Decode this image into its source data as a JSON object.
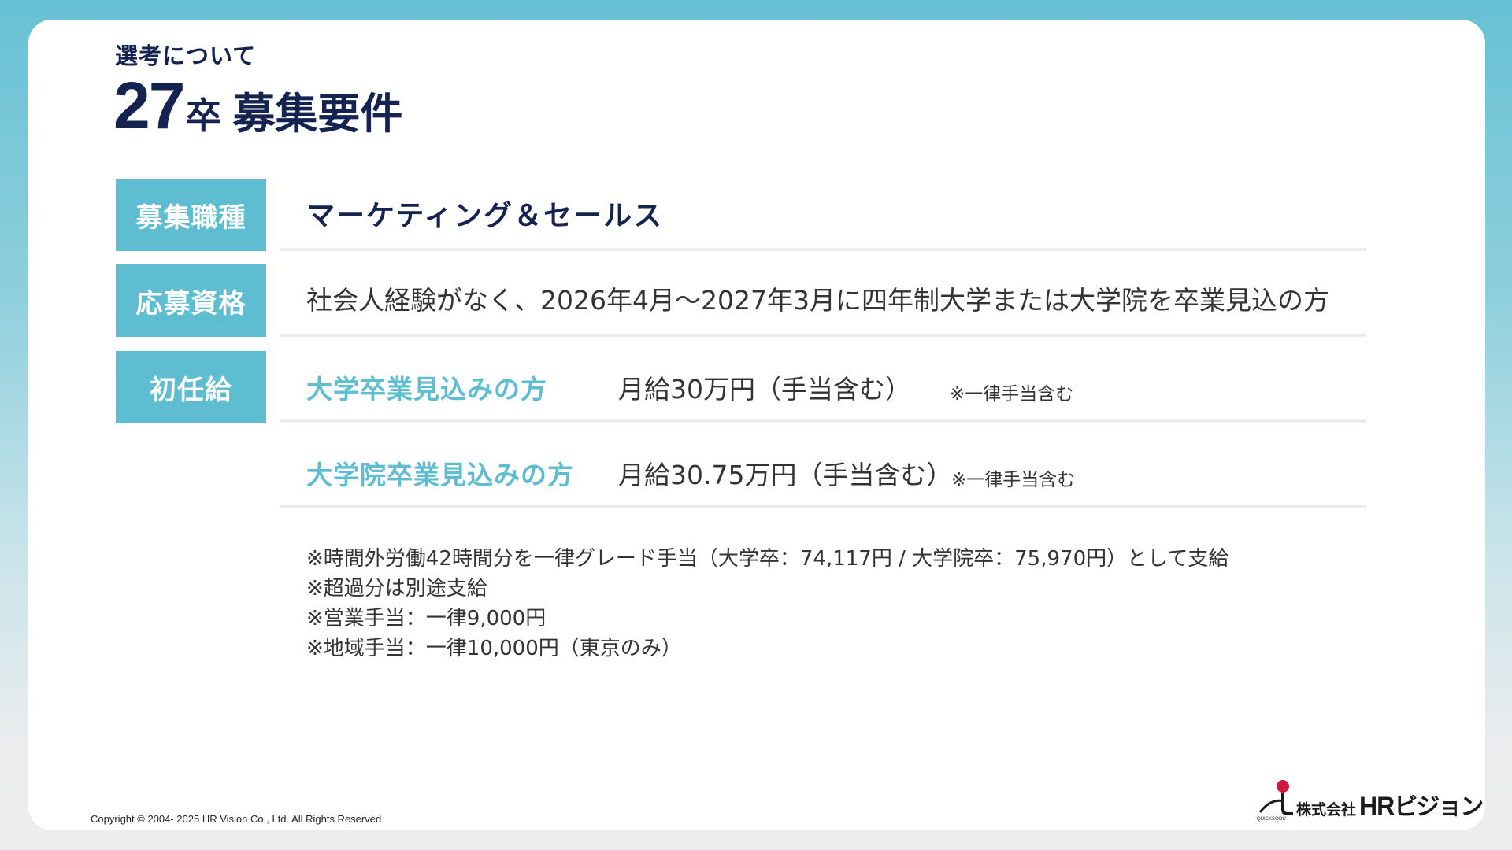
{
  "header": {
    "eyebrow": "選考について",
    "title_number": "27",
    "title_suffix": "卒",
    "title_main": "募集要件"
  },
  "rows": {
    "job": {
      "label": "募集職種",
      "value": "マーケティング＆セールス"
    },
    "qualification": {
      "label": "応募資格",
      "value": "社会人経験がなく、2026年4月～2027年3月に四年制大学または大学院を卒業見込の方"
    },
    "salary": {
      "label": "初任給",
      "undergrad": {
        "label": "大学卒業見込みの方",
        "amount": "月給30万円（手当含む）",
        "note": "※一律手当含む"
      },
      "graduate": {
        "label": "大学院卒業見込みの方",
        "amount": "月給30.75万円（手当含む）",
        "note": "※一律手当含む"
      }
    }
  },
  "notes": [
    "※時間外労働42時間分を一律グレード手当（大学卒：74,117円 / 大学院卒：75,970円）として支給",
    "※超過分は別途支給",
    "※営業手当：一律9,000円",
    "※地域手当：一律10,000円（東京のみ）"
  ],
  "footer": {
    "copyright": "Copyright © 2004- 2025 HR Vision Co., Ltd. All Rights Reserved",
    "logo_company_prefix": "株式会社",
    "logo_name_latin": "HR",
    "logo_name_kana": "ビジョン",
    "logo_tiny_text": "QUICKSQOU"
  },
  "colors": {
    "accent": "#5ebdd1",
    "navy": "#14234f",
    "divider": "#ececec",
    "logo_red": "#d0173e"
  }
}
